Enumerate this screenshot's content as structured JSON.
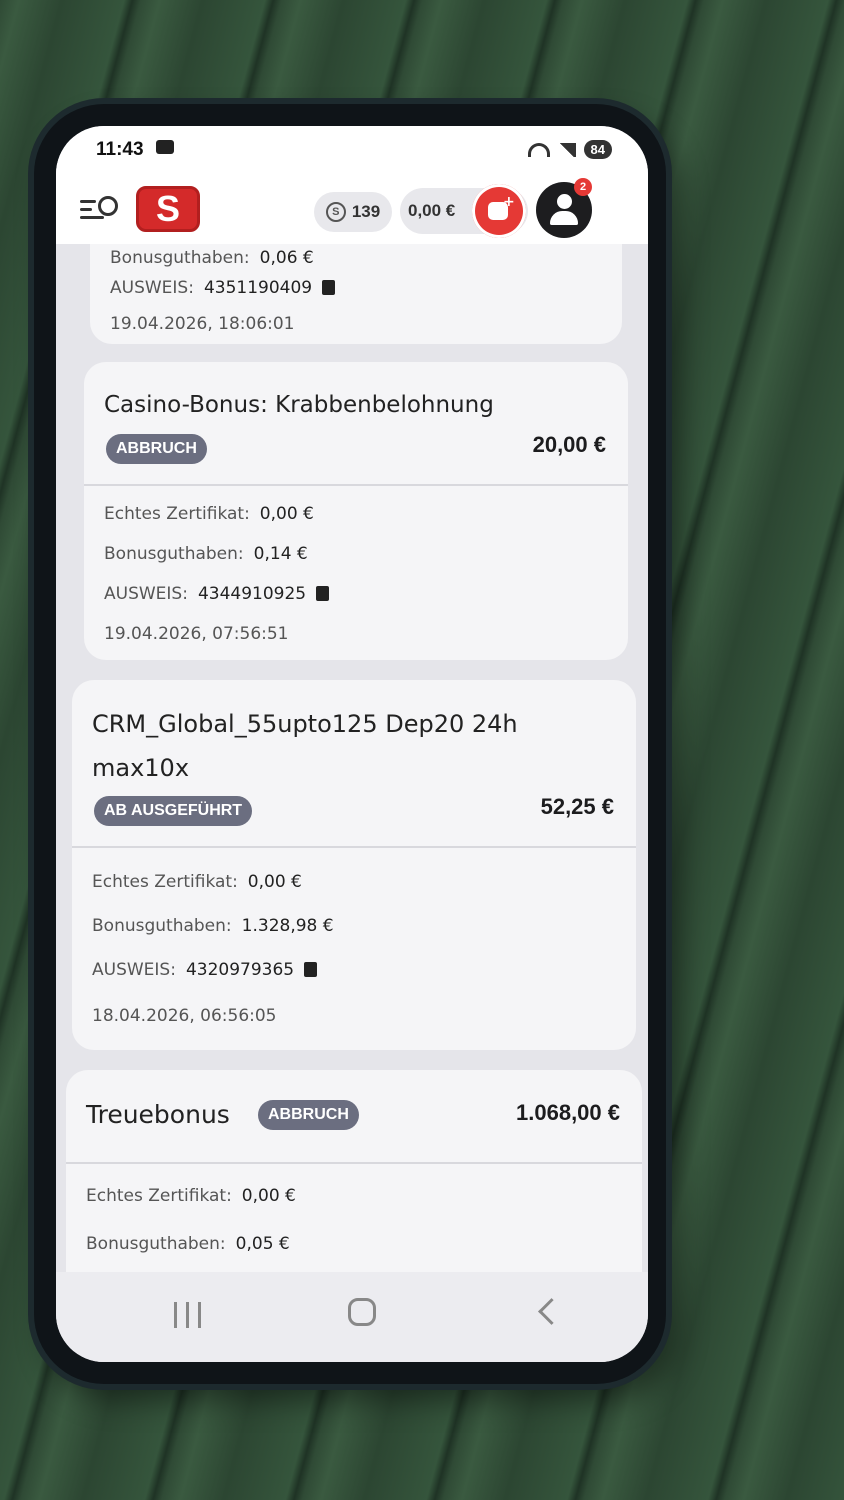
{
  "status_bar": {
    "time": "11:43",
    "battery": "84"
  },
  "header": {
    "logo": "S",
    "coins": "139",
    "balance": "0,00 €",
    "notification_count": "2"
  },
  "bonuses": [
    {
      "title": "",
      "partial_label": "Bonusguthaben:",
      "partial_value": "0,06 €",
      "id_label": "AUSWEIS:",
      "id_value": "4351190409",
      "date": "19.04.2026, 18:06:01"
    },
    {
      "title": "Casino-Bonus: Krabbenbelohnung",
      "status": "ABBRUCH",
      "amount": "20,00 €",
      "real_label": "Echtes Zertifikat:",
      "real_value": "0,00 €",
      "bonus_label": "Bonusguthaben:",
      "bonus_value": "0,14 €",
      "id_label": "AUSWEIS:",
      "id_value": "4344910925",
      "date": "19.04.2026, 07:56:51"
    },
    {
      "title_line1": "CRM_Global_55upto125 Dep20 24h",
      "title_line2": "max10x",
      "status": "AB AUSGEFÜHRT",
      "amount": "52,25 €",
      "real_label": "Echtes Zertifikat:",
      "real_value": "0,00 €",
      "bonus_label": "Bonusguthaben:",
      "bonus_value": "1.328,98 €",
      "id_label": "AUSWEIS:",
      "id_value": "4320979365",
      "date": "18.04.2026, 06:56:05"
    },
    {
      "title": "Treuebonus",
      "status": "ABBRUCH",
      "amount": "1.068,00 €",
      "real_label": "Echtes Zertifikat:",
      "real_value": "0,00 €",
      "bonus_label": "Bonusguthaben:",
      "bonus_value": "0,05 €"
    }
  ],
  "colors": {
    "accent": "#e53935",
    "badge": "#6b6e80",
    "card": "#f5f5f7",
    "background": "#e5e5ea"
  }
}
